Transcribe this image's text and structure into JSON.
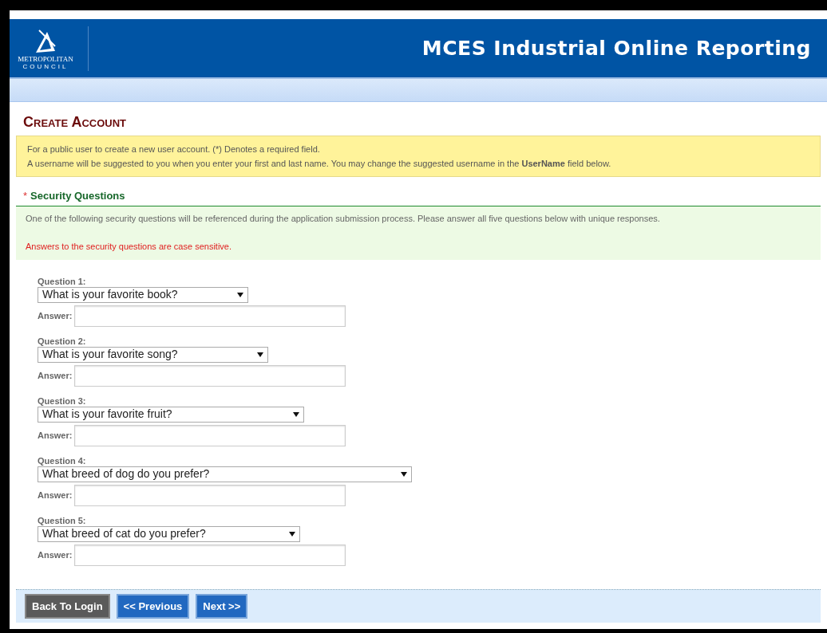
{
  "header": {
    "logo_name": "METROPOLITAN",
    "logo_sub": "COUNCIL",
    "title": "MCES Industrial Online Reporting"
  },
  "page_title": "Create Account",
  "notice": [
    "For a public user to create a new user account. (*) Denotes a required field.",
    "A username will be suggested to you when you enter your first and last name. You may change the suggested username in the **UserName** field below."
  ],
  "section": {
    "required_mark": "*",
    "title": "Security Questions",
    "description": "One of the following security questions will be referenced during the application submission process. Please answer all five questions below with unique responses.",
    "warning": "Answers to the security questions are case sensitive."
  },
  "questions": [
    {
      "label": "Question 1:",
      "value": "What is your favorite book?",
      "answer_label": "Answer:"
    },
    {
      "label": "Question 2:",
      "value": "What is your favorite song?",
      "answer_label": "Answer:"
    },
    {
      "label": "Question 3:",
      "value": "What is your favorite fruit?",
      "answer_label": "Answer:"
    },
    {
      "label": "Question 4:",
      "value": "What breed of dog do you prefer?",
      "answer_label": "Answer:"
    },
    {
      "label": "Question 5:",
      "value": "What breed of cat do you prefer?",
      "answer_label": "Answer:"
    }
  ],
  "buttons": [
    {
      "label": "Back To Login",
      "kind": "secondary"
    },
    {
      "label": "<< Previous",
      "kind": "primary"
    },
    {
      "label": "Next >>",
      "kind": "primary"
    }
  ]
}
